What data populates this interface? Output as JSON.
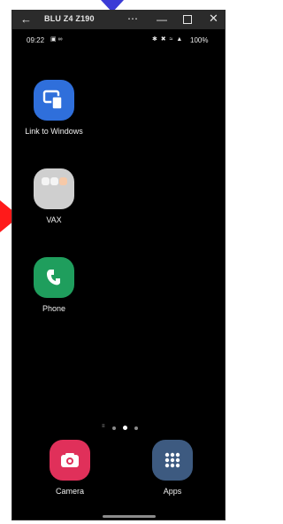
{
  "titlebar": {
    "back_icon": "back-arrow-icon",
    "title": "BLU Z4 Z190",
    "more_icon": "more-horizontal-icon",
    "minimize_icon": "minimize-icon",
    "maximize_icon": "maximize-icon",
    "close_icon": "close-icon"
  },
  "status_bar": {
    "time": "09:22",
    "battery": "100%"
  },
  "home_apps": [
    {
      "label": "Link to Windows",
      "color": "#2f6fdb"
    },
    {
      "label": "VAX",
      "color": "#cfcfcf"
    },
    {
      "label": "Phone",
      "color": "#1f9e5d"
    }
  ],
  "dock_apps": [
    {
      "label": "Camera",
      "color": "#e0305a"
    },
    {
      "label": "Apps",
      "color": "#3d5a80"
    }
  ],
  "pager": {
    "pages": 3,
    "active_page": 2
  },
  "annotations": {
    "top_arrow_color": "#3b3bd6",
    "left_arrow_color": "#ff1a1a"
  }
}
